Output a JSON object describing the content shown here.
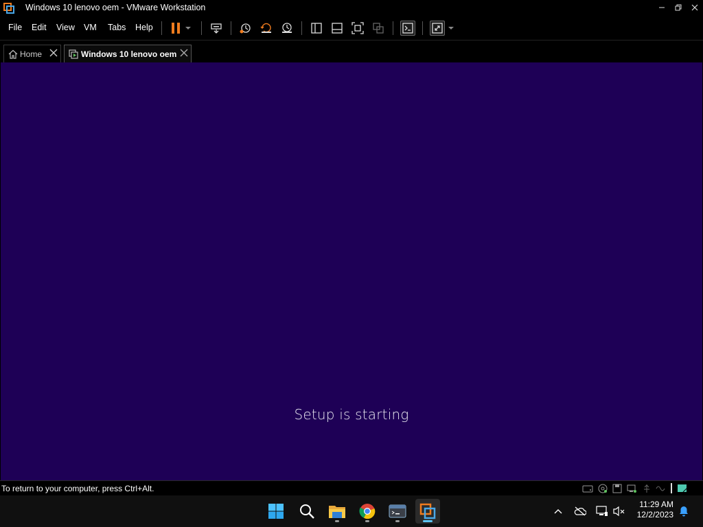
{
  "window": {
    "title": "Windows 10 lenovo oem - VMware Workstation",
    "controls": {
      "minimize": "—",
      "restore": "❐",
      "close": "✕"
    }
  },
  "menu": {
    "items": [
      "File",
      "Edit",
      "View",
      "VM",
      "Tabs",
      "Help"
    ]
  },
  "toolbar": {
    "icons": [
      "pause-icon",
      "dropdown-arrow-icon",
      "send-ctrl-alt-del-icon",
      "snapshot-take-icon",
      "snapshot-revert-icon",
      "snapshot-manager-icon",
      "library-view-icon",
      "thumbnail-view-icon",
      "full-screen-icon",
      "unity-icon",
      "console-view-icon",
      "stretch-guest-icon",
      "dropdown-arrow-icon"
    ],
    "accent": "#f07c1e"
  },
  "tabs": [
    {
      "label": "Home",
      "icon": "home-icon",
      "active": false
    },
    {
      "label": "Windows 10 lenovo oem",
      "icon": "vm-running-icon",
      "active": true
    }
  ],
  "vm": {
    "message": "Setup is starting",
    "background": "#1e0056"
  },
  "status": {
    "message": "To return to your computer, press Ctrl+Alt.",
    "device_icons": [
      "hard-disk-icon",
      "cd-rom-icon",
      "floppy-icon",
      "network-icon",
      "usb-icon",
      "sound-icon",
      "message-log-icon"
    ]
  },
  "taskbar": {
    "apps": [
      "start-icon",
      "search-icon",
      "file-explorer-icon",
      "chrome-icon",
      "terminal-icon",
      "vmware-workstation-icon"
    ],
    "tray": [
      "show-hidden-icons-chevron",
      "onedrive-offline-icon",
      "network-icon",
      "volume-muted-icon"
    ],
    "time": "11:29 AM",
    "date": "12/2/2023"
  }
}
